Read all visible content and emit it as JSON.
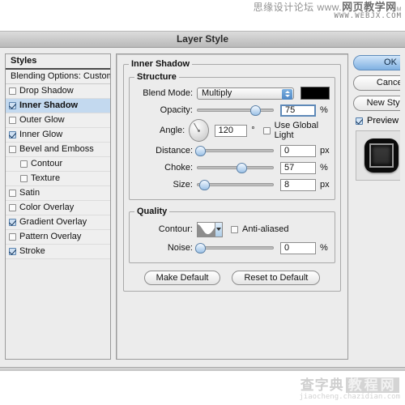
{
  "watermark": {
    "top_line1_cn": "思缘设计论坛",
    "top_line1_www": "www.",
    "top_line1_brand": "网页教学网",
    "top_line1_tm": "M",
    "top_line2": "WWW.WEBJX.COM",
    "bottom_brand": "查字典",
    "bottom_box": "教程网",
    "bottom_url": "jiaocheng.chazidian.com"
  },
  "window": {
    "title": "Layer Style"
  },
  "styles_panel": {
    "header": "Styles",
    "blending_options": "Blending Options: Custom",
    "items": [
      {
        "label": "Drop Shadow",
        "checked": false,
        "selected": false,
        "indent": false
      },
      {
        "label": "Inner Shadow",
        "checked": true,
        "selected": true,
        "indent": false
      },
      {
        "label": "Outer Glow",
        "checked": false,
        "selected": false,
        "indent": false
      },
      {
        "label": "Inner Glow",
        "checked": true,
        "selected": false,
        "indent": false
      },
      {
        "label": "Bevel and Emboss",
        "checked": false,
        "selected": false,
        "indent": false
      },
      {
        "label": "Contour",
        "checked": false,
        "selected": false,
        "indent": true
      },
      {
        "label": "Texture",
        "checked": false,
        "selected": false,
        "indent": true
      },
      {
        "label": "Satin",
        "checked": false,
        "selected": false,
        "indent": false
      },
      {
        "label": "Color Overlay",
        "checked": false,
        "selected": false,
        "indent": false
      },
      {
        "label": "Gradient Overlay",
        "checked": true,
        "selected": false,
        "indent": false
      },
      {
        "label": "Pattern Overlay",
        "checked": false,
        "selected": false,
        "indent": false
      },
      {
        "label": "Stroke",
        "checked": true,
        "selected": false,
        "indent": false
      }
    ]
  },
  "inner_shadow": {
    "section_title": "Inner Shadow",
    "structure": {
      "legend": "Structure",
      "blend_mode_label": "Blend Mode:",
      "blend_mode_value": "Multiply",
      "color_swatch": "#000000",
      "opacity_label": "Opacity:",
      "opacity_value": "75",
      "opacity_unit": "%",
      "opacity_percent": 75,
      "angle_label": "Angle:",
      "angle_value": "120",
      "angle_unit": "°",
      "use_global_light_label": "Use Global Light",
      "use_global_light_checked": false,
      "distance_label": "Distance:",
      "distance_value": "0",
      "distance_unit": "px",
      "distance_percent": 2,
      "choke_label": "Choke:",
      "choke_value": "57",
      "choke_unit": "%",
      "choke_percent": 57,
      "size_label": "Size:",
      "size_value": "8",
      "size_unit": "px",
      "size_percent": 7
    },
    "quality": {
      "legend": "Quality",
      "contour_label": "Contour:",
      "anti_aliased_label": "Anti-aliased",
      "anti_aliased_checked": false,
      "noise_label": "Noise:",
      "noise_value": "0",
      "noise_unit": "%",
      "noise_percent": 2
    },
    "buttons": {
      "make_default": "Make Default",
      "reset_to_default": "Reset to Default"
    }
  },
  "actions": {
    "ok": "OK",
    "cancel": "Cancel",
    "new_style": "New Style...",
    "preview_label": "Preview",
    "preview_checked": true
  }
}
